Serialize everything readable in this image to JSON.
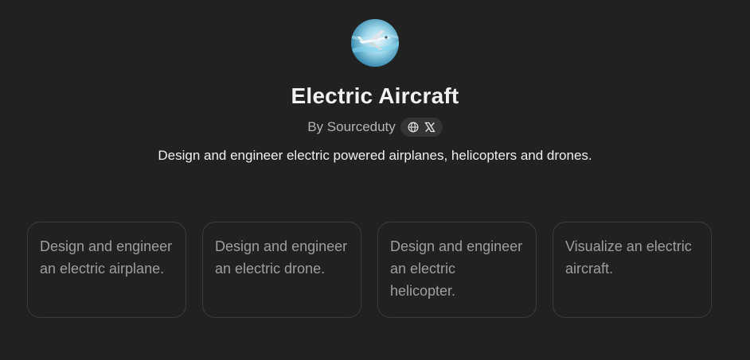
{
  "gpt": {
    "avatar_icon": "electric-aircraft-avatar",
    "title": "Electric Aircraft",
    "author": "By Sourceduty",
    "social_links": [
      "globe-icon",
      "x-logo-icon"
    ],
    "description": "Design and engineer electric powered airplanes, helicopters and drones."
  },
  "conversation_starters": [
    {
      "label": "Design and engineer an electric airplane."
    },
    {
      "label": "Design and engineer an electric drone."
    },
    {
      "label": "Design and engineer an electric helicopter."
    },
    {
      "label": "Visualize an electric aircraft."
    }
  ],
  "colors": {
    "background": "#212121",
    "card_border": "#3b3b3b",
    "pill_background": "#343434",
    "muted_text": "#b4b4b4"
  }
}
